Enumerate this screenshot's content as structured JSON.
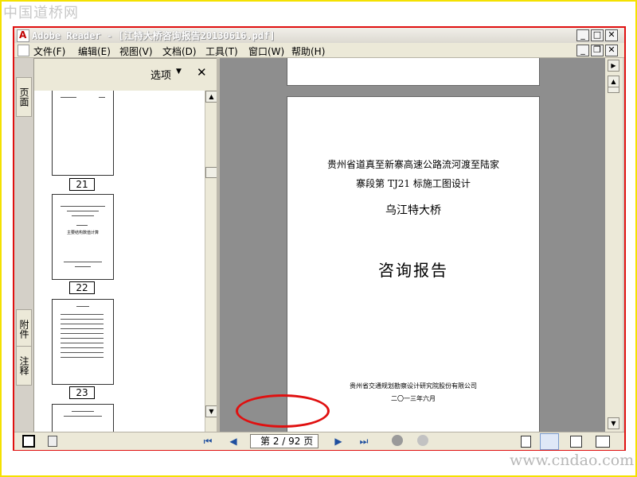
{
  "watermarks": {
    "top": "中国道桥网",
    "bottom": "www.cndao.com"
  },
  "window": {
    "title": "Adobe Reader - [江特大桥咨询报告20130616.pdf]"
  },
  "menus": [
    "文件(F)",
    "编辑(E)",
    "视图(V)",
    "文档(D)",
    "工具(T)",
    "窗口(W)",
    "帮助(H)"
  ],
  "sidebar": {
    "options_label": "选项",
    "tabs": [
      "页面",
      "附件",
      "注释"
    ]
  },
  "thumbnails": [
    {
      "page_label": "21"
    },
    {
      "page_label": "22",
      "caption": "主要结构数值计算"
    },
    {
      "page_label": "23"
    }
  ],
  "document": {
    "line1": "贵州省道真至新寨高速公路流河渡至陆家",
    "line2": "寨段第 TJ21 标施工图设计",
    "bridge": "乌江特大桥",
    "title": "咨询报告",
    "org": "贵州省交通规划勘察设计研究院股份有限公司",
    "date": "二〇一三年六月"
  },
  "statusbar": {
    "page_text": "第 2 / 92 页",
    "current_page": 2,
    "total_pages": 92
  },
  "colors": {
    "annotation_red": "#e01010",
    "frame_yellow": "#f4e100"
  }
}
